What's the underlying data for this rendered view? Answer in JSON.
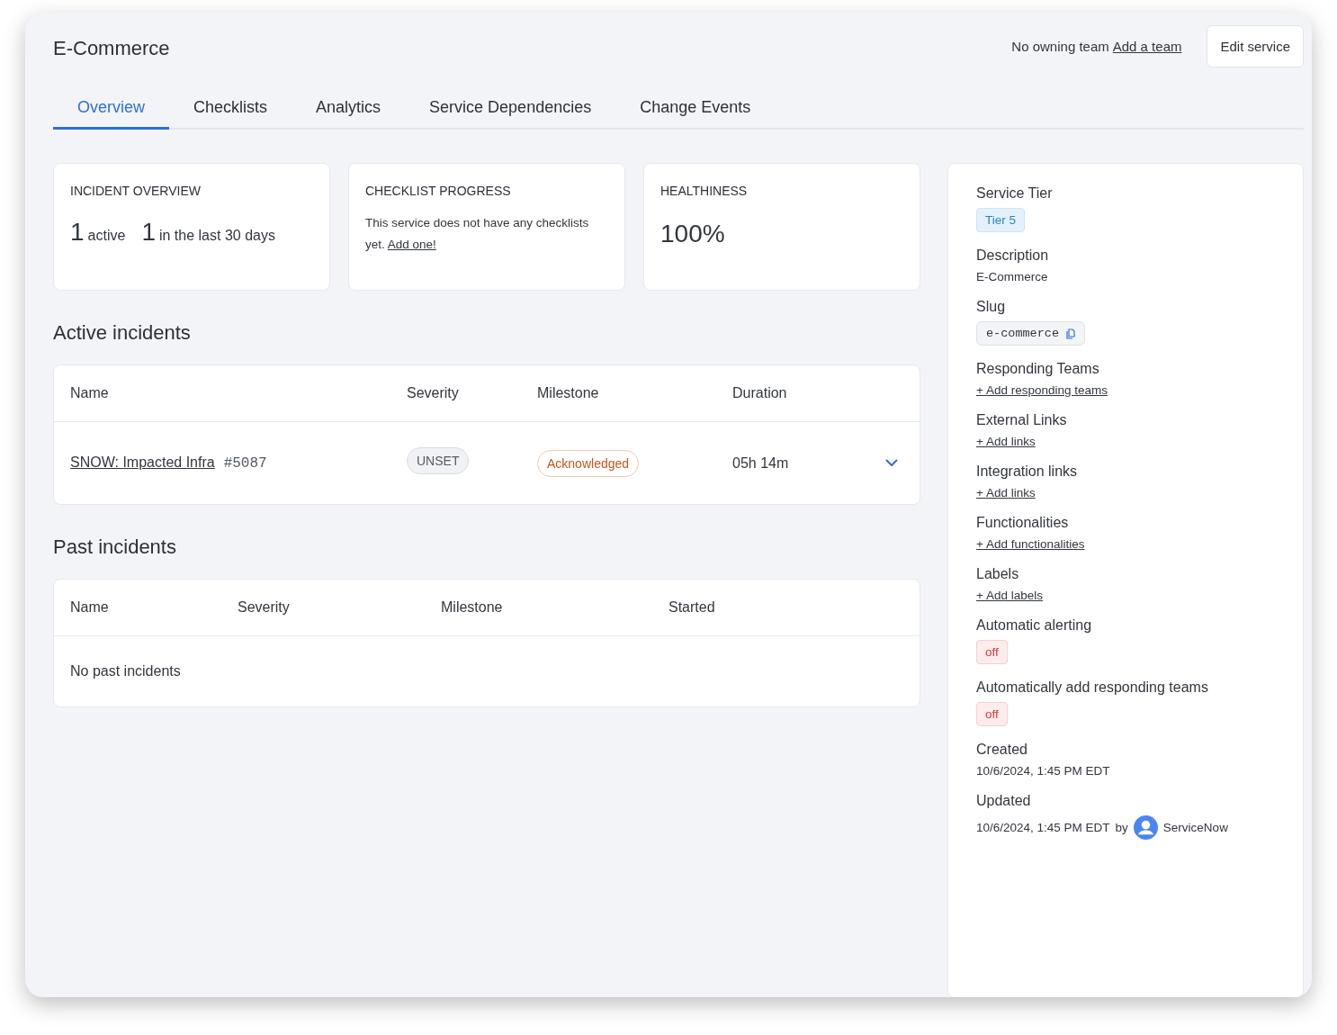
{
  "header": {
    "title": "E-Commerce",
    "owner_text": "No owning team",
    "owner_link": "Add a team",
    "edit_button": "Edit service"
  },
  "tabs": [
    {
      "label": "Overview",
      "selected": true
    },
    {
      "label": "Checklists",
      "selected": false
    },
    {
      "label": "Analytics",
      "selected": false
    },
    {
      "label": "Service Dependencies",
      "selected": false
    },
    {
      "label": "Change Events",
      "selected": false
    }
  ],
  "overview_cards": [
    {
      "kind": "counts",
      "title": "INCIDENT OVERVIEW",
      "counts": [
        {
          "number": "1",
          "label": "active"
        },
        {
          "number": "1",
          "label": "in the last 30 days"
        }
      ]
    },
    {
      "kind": "message",
      "title": "CHECKLIST PROGRESS",
      "text": "This service does not have any checklists yet.",
      "link": "Add one!"
    },
    {
      "kind": "big",
      "title": "HEALTHINESS",
      "value": "100%"
    }
  ],
  "active_incidents": {
    "title": "Active incidents",
    "columns": [
      "Name",
      "Severity",
      "Milestone",
      "Duration"
    ],
    "rows": [
      {
        "name": "SNOW: Impacted Infra",
        "number": "#5087",
        "severity": "UNSET",
        "milestone": "Acknowledged",
        "duration": "05h 14m",
        "expanded": false
      }
    ]
  },
  "past_incidents": {
    "title": "Past incidents",
    "columns": [
      "Name",
      "Severity",
      "Milestone",
      "Started"
    ],
    "empty_text": "No past incidents"
  },
  "sidebar": {
    "fields": [
      {
        "kind": "tag",
        "label": "Service Tier",
        "value": "Tier 5"
      },
      {
        "kind": "text",
        "label": "Description",
        "value": "E-Commerce"
      },
      {
        "kind": "code",
        "label": "Slug",
        "value": "e-commerce"
      },
      {
        "kind": "link",
        "label": "Responding Teams",
        "value": "+ Add responding teams"
      },
      {
        "kind": "link",
        "label": "External Links",
        "value": "+ Add links"
      },
      {
        "kind": "link",
        "label": "Integration links",
        "value": "+ Add links"
      },
      {
        "kind": "link",
        "label": "Functionalities",
        "value": "+ Add functionalities"
      },
      {
        "kind": "link",
        "label": "Labels",
        "value": "+ Add labels"
      },
      {
        "kind": "toggle",
        "label": "Automatic alerting",
        "on": false,
        "value": "off"
      },
      {
        "kind": "toggle",
        "label": "Automatically add responding teams",
        "on": false,
        "value": "off"
      },
      {
        "kind": "text",
        "label": "Created",
        "value": "10/6/2024, 1:45 PM EDT"
      },
      {
        "kind": "updated",
        "label": "Updated",
        "value": "10/6/2024, 1:45 PM EDT",
        "by": "by",
        "user": "ServiceNow"
      }
    ]
  }
}
